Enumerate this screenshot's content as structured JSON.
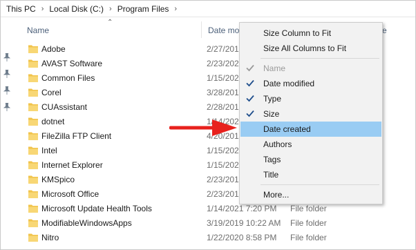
{
  "breadcrumb": [
    "This PC",
    "Local Disk (C:)",
    "Program Files"
  ],
  "columns": {
    "name": "Name",
    "date": "Date modi",
    "size": "ze"
  },
  "files": [
    {
      "name": "Adobe",
      "date": "2/27/201",
      "type": ""
    },
    {
      "name": "AVAST Software",
      "date": "2/23/202",
      "type": ""
    },
    {
      "name": "Common Files",
      "date": "1/15/202",
      "type": ""
    },
    {
      "name": "Corel",
      "date": "3/28/201",
      "type": ""
    },
    {
      "name": "CUAssistant",
      "date": "2/28/201",
      "type": ""
    },
    {
      "name": "dotnet",
      "date": "1/14/202",
      "type": ""
    },
    {
      "name": "FileZilla FTP Client",
      "date": "4/20/201",
      "type": ""
    },
    {
      "name": "Intel",
      "date": "1/15/202",
      "type": ""
    },
    {
      "name": "Internet Explorer",
      "date": "1/15/202",
      "type": ""
    },
    {
      "name": "KMSpico",
      "date": "2/23/201",
      "type": ""
    },
    {
      "name": "Microsoft Office",
      "date": "2/23/201",
      "type": ""
    },
    {
      "name": "Microsoft Update Health Tools",
      "date": "1/14/2021 7:20 PM",
      "type": "File folder"
    },
    {
      "name": "ModifiableWindowsApps",
      "date": "3/19/2019 10:22 AM",
      "type": "File folder"
    },
    {
      "name": "Nitro",
      "date": "1/22/2020 8:58 PM",
      "type": "File folder"
    }
  ],
  "menu": {
    "items": [
      {
        "label": "Size Column to Fit",
        "checked": false,
        "disabled": false,
        "highlighted": false
      },
      {
        "label": "Size All Columns to Fit",
        "checked": false,
        "disabled": false,
        "highlighted": false
      },
      {
        "label": "Name",
        "checked": true,
        "disabled": true,
        "highlighted": false
      },
      {
        "label": "Date modified",
        "checked": true,
        "disabled": false,
        "highlighted": false
      },
      {
        "label": "Type",
        "checked": true,
        "disabled": false,
        "highlighted": false
      },
      {
        "label": "Size",
        "checked": true,
        "disabled": false,
        "highlighted": false
      },
      {
        "label": "Date created",
        "checked": false,
        "disabled": false,
        "highlighted": true
      },
      {
        "label": "Authors",
        "checked": false,
        "disabled": false,
        "highlighted": false
      },
      {
        "label": "Tags",
        "checked": false,
        "disabled": false,
        "highlighted": false
      },
      {
        "label": "Title",
        "checked": false,
        "disabled": false,
        "highlighted": false
      },
      {
        "label": "More...",
        "checked": false,
        "disabled": false,
        "highlighted": false
      }
    ]
  },
  "colors": {
    "highlight": "#99ccf3",
    "checkmark": "#1f4e8c",
    "folder": "#f1c34a",
    "arrow": "#e8211d",
    "header_text": "#4c607a"
  },
  "icons": {
    "pin": "pin-icon",
    "folder": "folder-icon",
    "check": "checkmark-icon",
    "arrow": "red-arrow-annotation"
  }
}
